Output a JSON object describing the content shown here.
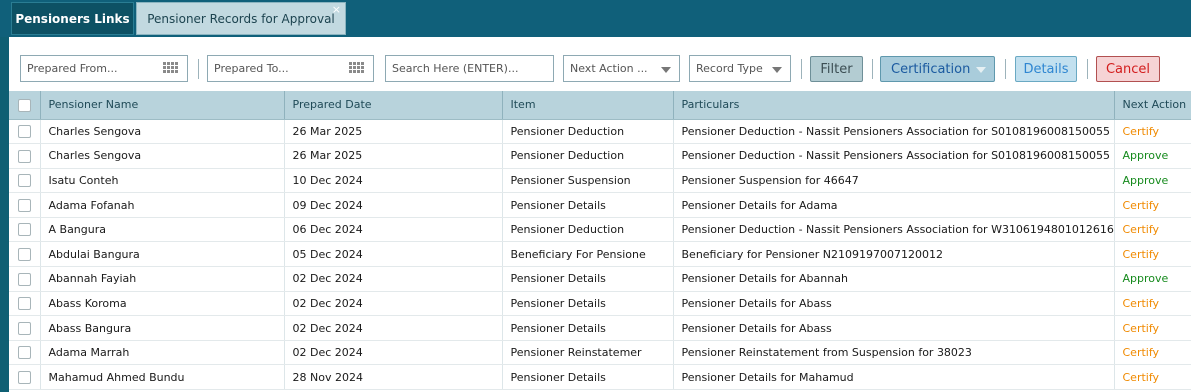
{
  "tabs": {
    "active_label": "Pensioners Links",
    "second_label": "Pensioner Records for Approval",
    "close_glyph": "×"
  },
  "toolbar": {
    "prepared_from_placeholder": "Prepared From...",
    "prepared_to_placeholder": "Prepared To...",
    "search_placeholder": "Search Here (ENTER)...",
    "next_action_label": "Next Action ...",
    "record_type_label": "Record Type",
    "filter_label": "Filter",
    "certification_label": "Certification",
    "details_label": "Details",
    "cancel_label": "Cancel"
  },
  "table": {
    "headers": [
      "Pensioner Name",
      "Prepared Date",
      "Item",
      "Particulars",
      "Next Action"
    ],
    "rows": [
      {
        "name": "Charles Sengova",
        "date": "26 Mar 2025",
        "item": "Pensioner Deduction",
        "particulars": "Pensioner Deduction - Nassit Pensioners Association for S0108196008150055",
        "action": "Certify"
      },
      {
        "name": "Charles Sengova",
        "date": "26 Mar 2025",
        "item": "Pensioner Deduction",
        "particulars": "Pensioner Deduction - Nassit Pensioners Association for S0108196008150055",
        "action": "Approve"
      },
      {
        "name": "Isatu Conteh",
        "date": "10 Dec 2024",
        "item": "Pensioner Suspension",
        "particulars": "Pensioner Suspension for 46647",
        "action": "Approve"
      },
      {
        "name": "Adama Fofanah",
        "date": "09 Dec 2024",
        "item": "Pensioner Details",
        "particulars": "Pensioner Details for Adama",
        "action": "Certify"
      },
      {
        "name": "A Bangura",
        "date": "06 Dec 2024",
        "item": "Pensioner Deduction",
        "particulars": "Pensioner Deduction - Nassit Pensioners Association for W3106194801012616",
        "action": "Certify"
      },
      {
        "name": "Abdulai Bangura",
        "date": "05 Dec 2024",
        "item": "Beneficiary For Pensione",
        "particulars": "Beneficiary for Pensioner N2109197007120012",
        "action": "Certify"
      },
      {
        "name": "Abannah Fayiah",
        "date": "02 Dec 2024",
        "item": "Pensioner Details",
        "particulars": "Pensioner Details for Abannah",
        "action": "Approve"
      },
      {
        "name": "Abass Koroma",
        "date": "02 Dec 2024",
        "item": "Pensioner Details",
        "particulars": "Pensioner Details for Abass",
        "action": "Certify"
      },
      {
        "name": "Abass Bangura",
        "date": "02 Dec 2024",
        "item": "Pensioner Details",
        "particulars": "Pensioner Details for Abass",
        "action": "Certify"
      },
      {
        "name": "Adama Marrah",
        "date": "02 Dec 2024",
        "item": "Pensioner Reinstatemer",
        "particulars": "Pensioner Reinstatement from Suspension for 38023",
        "action": "Certify"
      },
      {
        "name": "Mahamud Ahmed Bundu",
        "date": "28 Nov 2024",
        "item": "Pensioner Details",
        "particulars": "Pensioner Details for Mahamud",
        "action": "Certify"
      }
    ]
  },
  "colors": {
    "certify": "#f08a00",
    "approve": "#158a1c",
    "header_bg": "#b8d3dc",
    "tabbar_bg": "#10607a"
  }
}
